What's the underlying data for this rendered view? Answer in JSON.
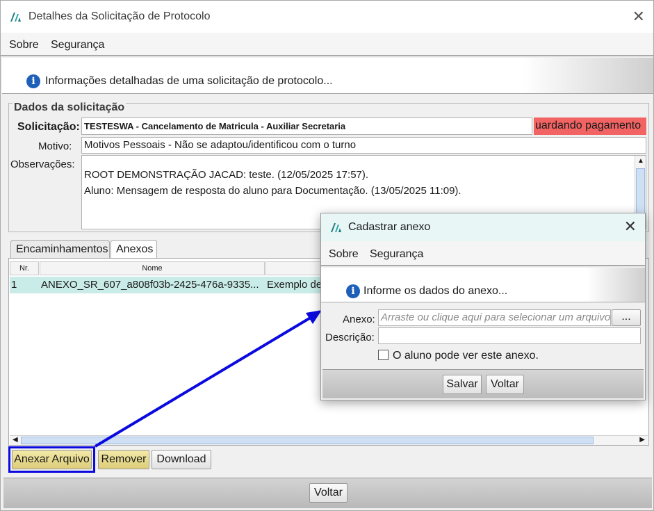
{
  "window": {
    "title": "Detalhes da Solicitação de Protocolo",
    "close_glyph": "✕"
  },
  "menu": {
    "items": [
      "Sobre",
      "Segurança"
    ]
  },
  "info": {
    "text": "Informações detalhadas de uma solicitação de protocolo..."
  },
  "dados": {
    "legend": "Dados da solicitação",
    "solicitacao_label": "Solicitação:",
    "solicitacao_value": "TESTESWA - Cancelamento de Matricula - Auxiliar Secretaria",
    "status": "uardando pagamento",
    "motivo_label": "Motivo:",
    "motivo_value": "Motivos Pessoais - Não se adaptou/identificou com o turno",
    "obs_label": "Observações:",
    "obs_lines": [
      "ROOT DEMONSTRAÇÃO JACAD: teste. (12/05/2025 17:57).",
      "Aluno: Mensagem de resposta do aluno para Documentação. (13/05/2025 11:09)."
    ]
  },
  "tabs": [
    "Encaminhamentos",
    "Anexos"
  ],
  "table": {
    "columns": [
      "Nr.",
      "Nome"
    ],
    "rows": [
      {
        "nr": "1",
        "nome": "ANEXO_SR_607_a808f03b-2425-476a-9335...",
        "desc": "Exemplo de"
      }
    ]
  },
  "buttons": {
    "anexar": "Anexar Arquivo",
    "remover": "Remover",
    "download": "Download",
    "voltar": "Voltar"
  },
  "dialog": {
    "title": "Cadastrar anexo",
    "menu": [
      "Sobre",
      "Segurança"
    ],
    "info": "Informe os dados do anexo...",
    "anexo_label": "Anexo:",
    "anexo_placeholder": "Arraste ou clique aqui para selecionar um arquivo",
    "browse": "...",
    "descricao_label": "Descrição:",
    "checkbox_label": "O aluno pode ver este anexo.",
    "salvar": "Salvar",
    "voltar": "Voltar"
  },
  "colors": {
    "status_bg": "#f26363",
    "selected_row": "#c9ece8",
    "highlight_blue": "#0a0ae0",
    "yellow_button": "#e6d98b"
  },
  "icons": [
    "app-logo-icon",
    "info-icon",
    "close-icon",
    "checkbox-icon"
  ]
}
